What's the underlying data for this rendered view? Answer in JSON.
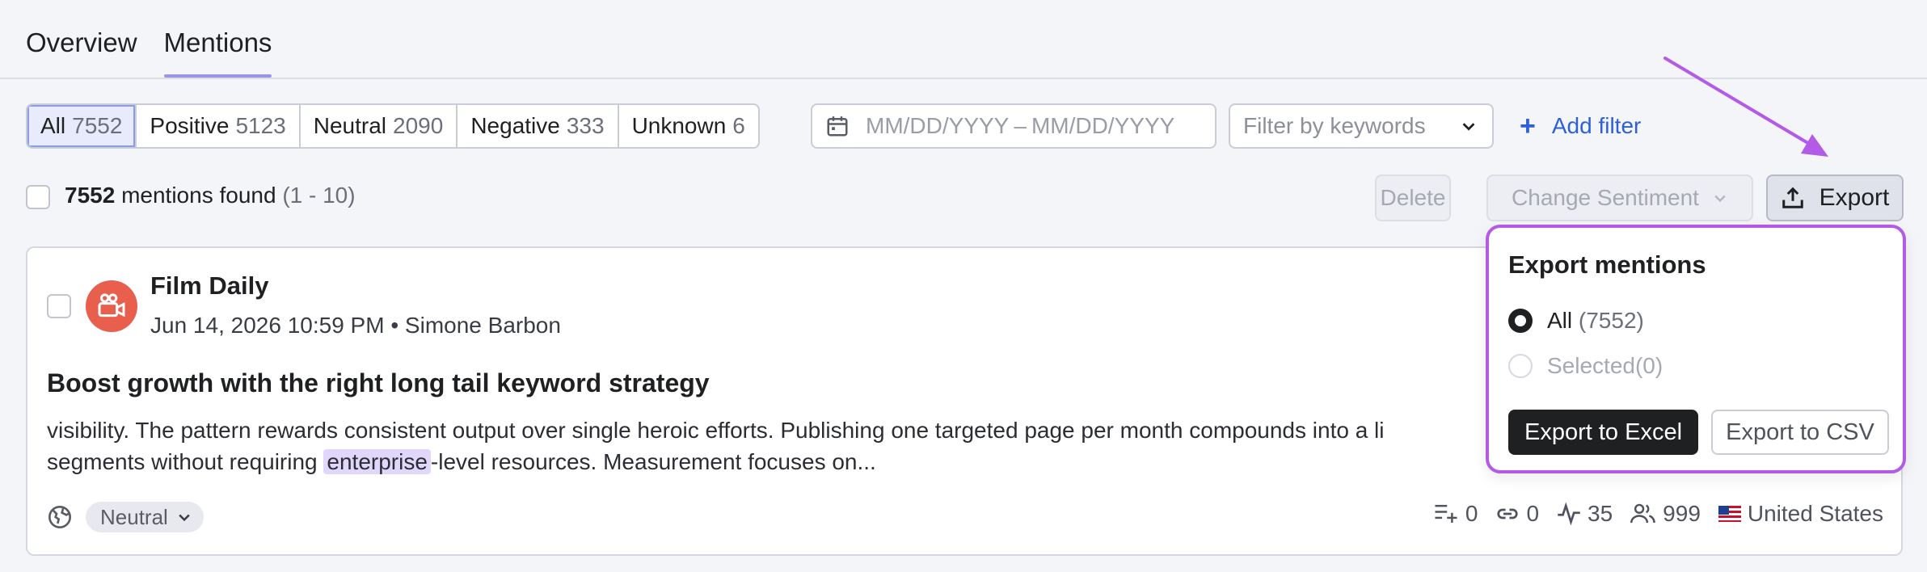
{
  "tabs": [
    {
      "label": "Overview",
      "active": false
    },
    {
      "label": "Mentions",
      "active": true
    }
  ],
  "sentiment_filter": {
    "items": [
      {
        "label": "All",
        "count": "7552",
        "active": true
      },
      {
        "label": "Positive",
        "count": "5123"
      },
      {
        "label": "Neutral",
        "count": "2090"
      },
      {
        "label": "Negative",
        "count": "333"
      },
      {
        "label": "Unknown",
        "count": "6"
      }
    ]
  },
  "date_range": {
    "start_placeholder": "MM/DD/YYYY",
    "separator": "–",
    "end_placeholder": "MM/DD/YYYY"
  },
  "keywords_filter": {
    "placeholder": "Filter by keywords"
  },
  "add_filter": {
    "label": "Add filter"
  },
  "results": {
    "count": "7552",
    "text": "mentions found",
    "range": "(1 - 10)"
  },
  "actions": {
    "delete": "Delete",
    "change_sentiment": "Change Sentiment",
    "export": "Export"
  },
  "mention": {
    "source": "Film Daily",
    "date": "Jun 14, 2026 10:59 PM",
    "bullet": "•",
    "author": "Simone Barbon",
    "title": "Boost growth with the right long tail keyword strategy",
    "body_part1": "visibility. The pattern rewards consistent output over single heroic efforts. Publishing one targeted page per month compounds into a li",
    "body_part2": "segments without requiring ",
    "highlight": "enterprise",
    "body_part3": "-level resources. Measurement focuses on...",
    "sentiment": "Neutral",
    "stats": {
      "posts": "0",
      "links": "0",
      "activity": "35",
      "reach": "999"
    },
    "country": "United States"
  },
  "export_popover": {
    "title": "Export mentions",
    "option_all": "All",
    "option_all_count": "(7552)",
    "option_selected": "Selected",
    "option_selected_count": "(0)",
    "excel": "Export to Excel",
    "csv": "Export to CSV"
  },
  "colors": {
    "accent": "#2d5fd8",
    "highlight": "#e1d6fb",
    "annotation": "#b35be6",
    "avatar": "#e95f4d"
  }
}
